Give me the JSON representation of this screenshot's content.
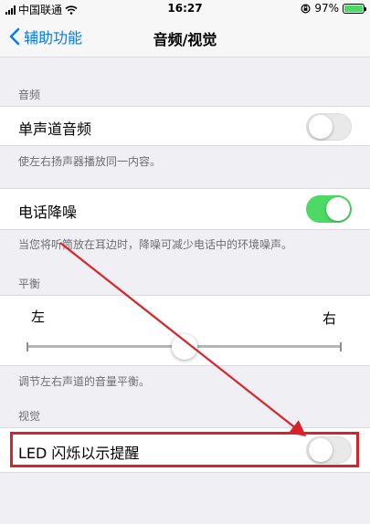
{
  "status": {
    "carrier": "中国联通",
    "time": "16:27",
    "battery": "97%"
  },
  "nav": {
    "back_label": "辅助功能",
    "title": "音频/视觉"
  },
  "audio": {
    "header": "音频",
    "mono_label": "单声道音频",
    "mono_on": false,
    "mono_footer": "使左右扬声器播放同一内容。",
    "noise_label": "电话降噪",
    "noise_on": true,
    "noise_footer": "当您将听筒放在耳边时，降噪可减少电话中的环境噪声。"
  },
  "balance": {
    "header": "平衡",
    "left": "左",
    "right": "右",
    "value": 0.5,
    "footer": "调节左右声道的音量平衡。"
  },
  "visual": {
    "header": "视觉",
    "led_label": "LED 闪烁以示提醒",
    "led_on": false
  },
  "colors": {
    "accent": "#007aff",
    "switch_on": "#4cd964",
    "annotation": "#d9232b"
  }
}
